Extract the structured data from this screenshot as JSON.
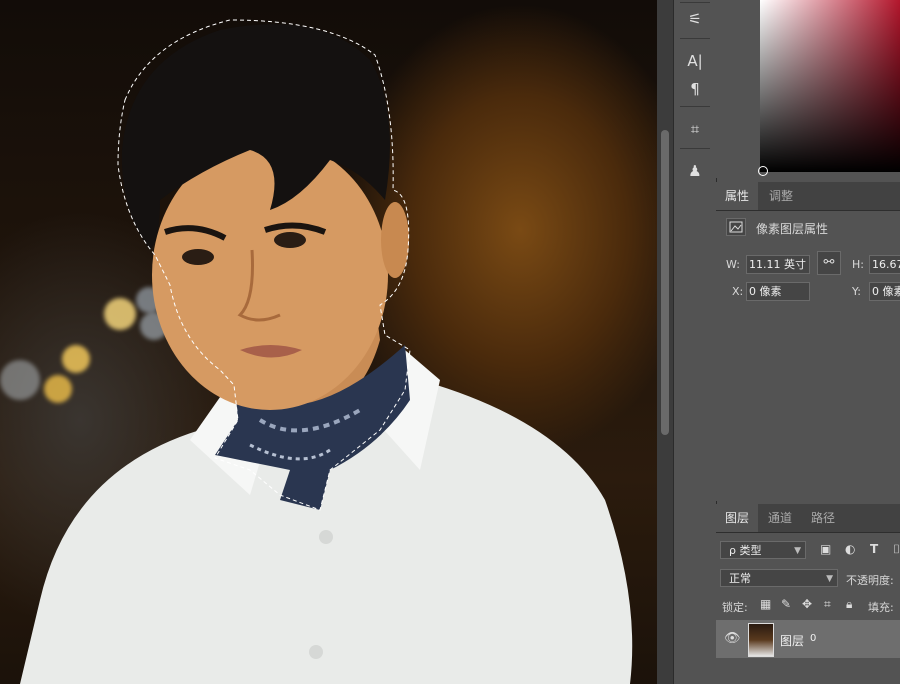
{
  "toolbar": {
    "tools": [
      {
        "name": "adjust-sliders-icon",
        "glyph": "⚟"
      },
      {
        "name": "character-icon",
        "glyph": "A|"
      },
      {
        "name": "paragraph-icon",
        "glyph": "¶"
      },
      {
        "name": "crop-icon",
        "glyph": "⌗"
      },
      {
        "name": "puppet-icon",
        "glyph": "♟"
      }
    ]
  },
  "properties_panel": {
    "tabs": [
      {
        "label": "属性",
        "active": true
      },
      {
        "label": "调整",
        "active": false
      }
    ],
    "section_title": "像素图层属性",
    "w_label": "W:",
    "w_value": "11.11 英寸",
    "h_label": "H:",
    "h_value": "16.67",
    "x_label": "X:",
    "x_value": "0 像素",
    "y_label": "Y:",
    "y_value": "0 像素"
  },
  "layers_panel": {
    "tabs": [
      {
        "label": "图层",
        "active": true
      },
      {
        "label": "通道",
        "active": false
      },
      {
        "label": "路径",
        "active": false
      }
    ],
    "filter_label": "ρ 类型",
    "blend_mode": "正常",
    "opacity_label": "不透明度:",
    "lock_label": "锁定:",
    "fill_label": "填充:",
    "layer": {
      "name": "图层",
      "number": "0"
    }
  },
  "colors": {
    "panel_bg": "#535353",
    "active_layer_bg": "#6e6e6e",
    "color_field_hue": "#b3162c"
  }
}
